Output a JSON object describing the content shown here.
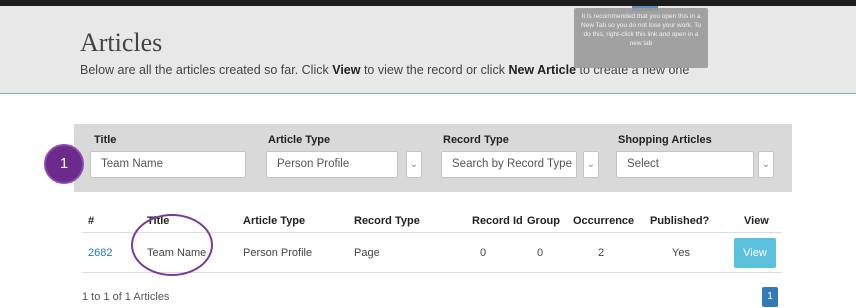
{
  "header": {
    "title": "Articles",
    "subtitle": {
      "part1": "Below are all the articles created so far. Click ",
      "view_word": "View",
      "part2": " to view the record or click ",
      "new_article_word": "New Article",
      "part3": " to create a new one"
    }
  },
  "tooltip": {
    "text": "It is recommended that you open this in a New Tab so you do not lose your work. To do this, right-click this link and open in a new tab"
  },
  "step_badge": "1",
  "filters": {
    "title": {
      "label": "Title",
      "value": "Team Name"
    },
    "article_type": {
      "label": "Article Type",
      "value": "Person Profile"
    },
    "record_type": {
      "label": "Record Type",
      "placeholder": "Search by Record Type"
    },
    "shopping_articles": {
      "label": "Shopping Articles",
      "value": "Select"
    }
  },
  "table": {
    "columns": [
      "#",
      "Title",
      "Article Type",
      "Record Type",
      "Record Id",
      "Group",
      "Occurrence",
      "Published?",
      "View"
    ],
    "rows": [
      {
        "id": "2682",
        "title": "Team Name",
        "article_type": "Person Profile",
        "record_type": "Page",
        "record_id": "0",
        "group": "0",
        "occurrence": "2",
        "published": "Yes",
        "view_label": "View"
      }
    ]
  },
  "pagination": {
    "info": "1 to 1 of 1 Articles",
    "current_page": "1"
  },
  "colors": {
    "accent_blue": "#5bc0de",
    "link_blue": "#2a7ab8",
    "annotation_purple": "#6b2a8c",
    "page_blue": "#337ab7"
  },
  "icons": {
    "dropdown": "chevron-down-icon"
  }
}
